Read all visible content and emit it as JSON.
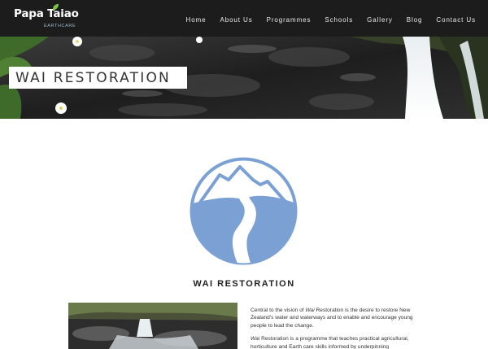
{
  "brand": {
    "name": "Papa Taiao",
    "subtitle": "EARTHCARE",
    "leaf_color": "#7cc242"
  },
  "nav": {
    "items": [
      "Home",
      "About Us",
      "Programmes",
      "Schools",
      "Gallery",
      "Blog",
      "Contact Us"
    ]
  },
  "hero": {
    "title": "WAI RESTORATION"
  },
  "emblem": {
    "icon": "river-mountains-icon",
    "color": "#7ba1d4"
  },
  "section": {
    "title": "WAI RESTORATION"
  },
  "content": {
    "para1_prefix": "Central to the vision of ",
    "para1_em": "Wai",
    "para1_suffix": " Restoration is the desire to restore New Zealand's water and waterways and to enable and encourage young people to lead the change.",
    "para2_em": "Wai",
    "para2_suffix": " Restoration is a programme that teaches practical agricultural, horticulture and Earth care skills informed by underpinning"
  },
  "colors": {
    "topbar": "#1c1c1c",
    "accent_blue": "#7ba1d4"
  }
}
